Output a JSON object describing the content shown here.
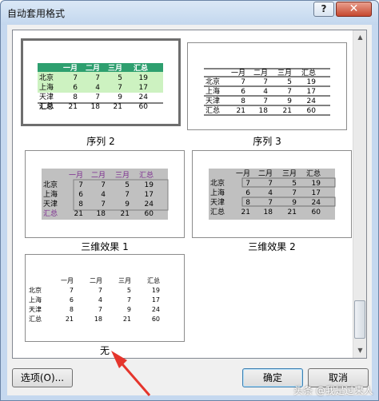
{
  "window": {
    "title": "自动套用格式",
    "help_label": "?",
    "close_label": "✕"
  },
  "table": {
    "headers": [
      "一月",
      "二月",
      "三月",
      "汇总"
    ],
    "rows": [
      {
        "label": "北京",
        "values": [
          "7",
          "7",
          "5",
          "19"
        ]
      },
      {
        "label": "上海",
        "values": [
          "6",
          "4",
          "7",
          "17"
        ]
      },
      {
        "label": "天津",
        "values": [
          "8",
          "7",
          "9",
          "24"
        ]
      },
      {
        "label": "汇总",
        "values": [
          "21",
          "18",
          "21",
          "60"
        ]
      }
    ]
  },
  "formats": [
    {
      "caption": "序列 2",
      "selected": true
    },
    {
      "caption": "序列 3",
      "selected": false
    },
    {
      "caption": "三维效果 1",
      "selected": false
    },
    {
      "caption": "三维效果 2",
      "selected": false
    },
    {
      "caption": "无",
      "selected": false
    }
  ],
  "colors": {
    "seq2_header": "#2e9f6f",
    "seq2_row": "#cdf2c1",
    "purple": "#7b2a8f",
    "grey": "#c0c0c0",
    "arrow": "#e5352c"
  },
  "buttons": {
    "options": "选项(O)...",
    "ok": "确定",
    "cancel": "取消"
  },
  "watermark": "头条 @我是过来人"
}
